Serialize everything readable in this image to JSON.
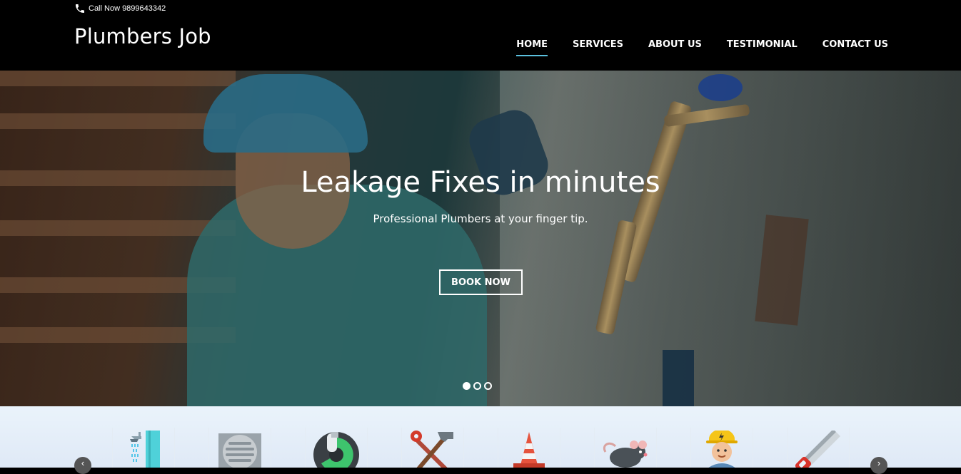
{
  "header": {
    "phone_text": "Call Now 9899643342",
    "brand": "Plumbers Job",
    "nav": [
      {
        "label": "HOME",
        "active": true
      },
      {
        "label": "SERVICES",
        "active": false
      },
      {
        "label": "ABOUT US",
        "active": false
      },
      {
        "label": "TESTIMONIAL",
        "active": false
      },
      {
        "label": "CONTACT US",
        "active": false
      }
    ]
  },
  "hero": {
    "title": "Leakage Fixes in minutes",
    "subtitle": "Professional Plumbers at your finger tip.",
    "button": "BOOK NOW",
    "slides_total": 3,
    "active_slide": 1
  },
  "services": {
    "icons": [
      "shower-icon",
      "drain-grate-icon",
      "pipe-gauge-icon",
      "hammer-wrench-icon",
      "traffic-cone-icon",
      "rat-icon",
      "electrician-icon",
      "hand-saw-icon"
    ],
    "prev_arrow": "‹",
    "next_arrow": "›"
  },
  "colors": {
    "accent": "#5bc0de",
    "header_bg": "#000000",
    "strip_bg": "#e6eff9"
  }
}
